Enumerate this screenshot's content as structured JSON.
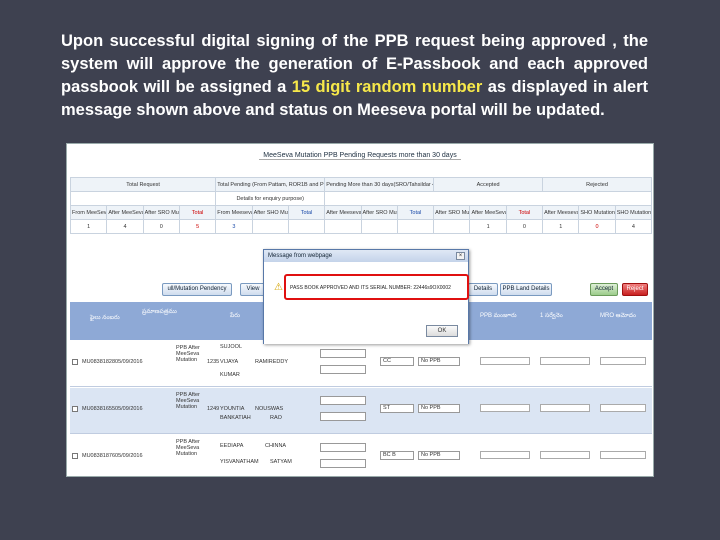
{
  "slide": {
    "text_part1": "Upon successful digital signing of the PPB request being approved , the system will approve the generation of E-Passbook and each approved passbook will be assigned a ",
    "text_highlight": "15 digit random number",
    "text_part2": " as displayed in alert message shown above and status on Meeseva portal will be updated."
  },
  "app": {
    "title": "MeeSeva Mutation PPB Pending Requests more than 30 days",
    "summary": {
      "group_headers": [
        "Total Request",
        "Total Pending (From Pattam, ROR1B and Ppd",
        "Pending More than 30 days(SRO/Tahsildar 48 days",
        "Accepted",
        "Rejected"
      ],
      "details_note": "Details for enquiry purpose)",
      "sub_headers": [
        "From MeeSeva",
        "After MeeSeva Mutation",
        "After SRO Mutation",
        "Total",
        "From Meeseva",
        "After SHO Mutation",
        "Total",
        "After Meeseva",
        "After SRO Mutation",
        "Total",
        "After SRO Mutation",
        "After MeeSeva Mutation",
        "SHO Mutation",
        "Total",
        "After Meeseva",
        "SHO Mutation"
      ],
      "accepted_label": "Accepted",
      "values": [
        "1",
        "4",
        "0",
        "5",
        "3",
        "",
        "",
        "",
        "",
        "",
        "",
        "1",
        "0",
        "1",
        "0",
        "4"
      ]
    },
    "buttons": {
      "view_pending": "ull/Mutation Pendency",
      "view": "View",
      "details": "Details",
      "ppb_details": "PPB Land Details",
      "accept": "Accept",
      "reject": "Reject"
    },
    "dialog": {
      "title": "Message from webpage",
      "message": "PASS BOOK APPROVED AND ITS SERIAL NUMBER: 22446s9OX0002",
      "ok": "OK",
      "close": "×"
    },
    "rows": [
      {
        "id": "MU0838182805/09/2016",
        "type": "PPB After MeeSeva Mutation",
        "num": "1235",
        "name": "VIJAYA",
        "father": "RAMIREDDY",
        "survey": "SUJOOL",
        "extra": "KUMAR",
        "c1": "CC",
        "pp": "No PPB"
      },
      {
        "id": "MU0838165505/09/2016",
        "type": "PPB After MeeSeva Mutation",
        "num": "1249",
        "name": "YOUNTIA",
        "father": "NOUSWAS",
        "survey": "BANKATIAH",
        "extra": "RAO",
        "c1": "ST",
        "pp": "No PPB"
      },
      {
        "id": "MU0838187605/09/2016",
        "type": "PPB After MeeSeva Mutation",
        "num": "",
        "name": "EEDIAPA",
        "father": "CHINNA",
        "survey": "YISVANATHAM",
        "extra": "SATYAM",
        "c1": "BC B",
        "pp": "No PPB"
      }
    ]
  },
  "colors": {
    "background": "#3e4150",
    "highlight_text": "#f6e84a",
    "grid_header": "#8ea9d6",
    "alert_box": "#e01010"
  }
}
